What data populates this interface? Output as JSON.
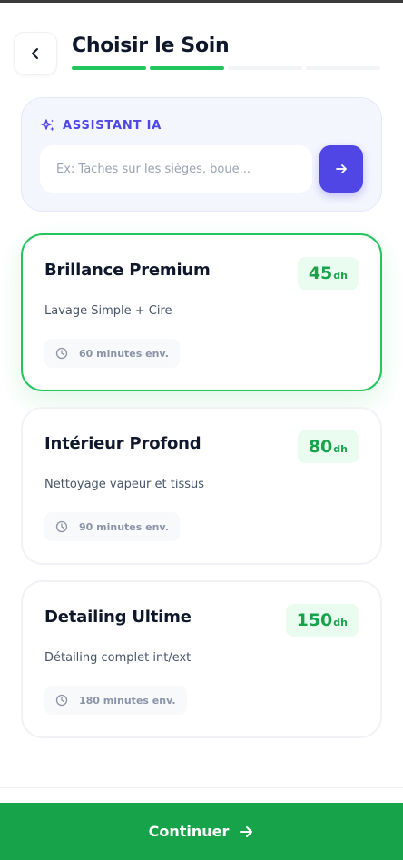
{
  "header": {
    "title": "Choisir le Soin",
    "steps_total": 4,
    "steps_completed": 2
  },
  "assistant": {
    "label": "ASSISTANT IA",
    "input_value": "",
    "placeholder": "Ex: Taches sur les sièges, boue..."
  },
  "services": [
    {
      "name": "Brillance Premium",
      "price": "45",
      "unit": "dh",
      "description": "Lavage Simple + Cire",
      "duration": "60 minutes env.",
      "selected": true
    },
    {
      "name": "Intérieur Profond",
      "price": "80",
      "unit": "dh",
      "description": "Nettoyage vapeur et tissus",
      "duration": "90 minutes env.",
      "selected": false
    },
    {
      "name": "Detailing Ultime",
      "price": "150",
      "unit": "dh",
      "description": "Détailing complet int/ext",
      "duration": "180 minutes env.",
      "selected": false
    }
  ],
  "footer": {
    "continue_label": "Continuer"
  },
  "colors": {
    "accent_green": "#16a34a",
    "progress_green": "#22c55e",
    "assistant_indigo": "#4f46e5",
    "price_bg": "#eafbf0"
  },
  "icons": {
    "back": "chevron-left-icon",
    "assistant": "sparkles-icon",
    "send": "arrow-right-icon",
    "duration": "clock-icon",
    "continue": "arrow-right-icon"
  }
}
